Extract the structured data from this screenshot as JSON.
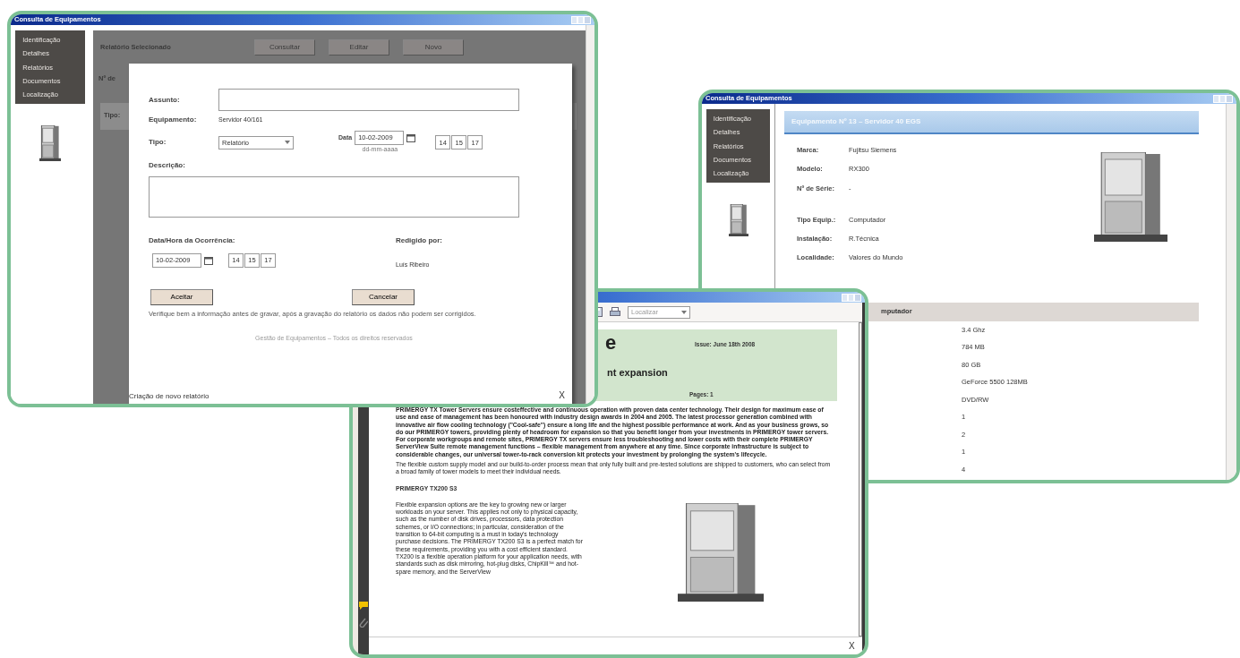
{
  "report_window": {
    "title": "Consulta de Equipamentos",
    "menu": [
      "Identificação",
      "Detalhes",
      "Relatórios",
      "Documentos",
      "Localização"
    ],
    "background": {
      "label": "Relatório Selecionado",
      "buttons": [
        "Consultar",
        "Editar",
        "Novo"
      ],
      "count_label": "Nº de",
      "column": "Tipo:"
    },
    "dialog": {
      "subject_label": "Assunto:",
      "equipment_label": "Equipamento:",
      "equipment": "Servidor 40/161",
      "type_label": "Tipo:",
      "type": "Relatório",
      "date_label": "Data",
      "date": "10-02-2009",
      "time": [
        "14",
        "15",
        "17"
      ],
      "date_hint": "dd-mm-aaaa",
      "description_label": "Descrição:",
      "occurrence_label": "Data/Hora da Ocorrência:",
      "occurrence_date": "10-02-2009",
      "occurrence_time": [
        "14",
        "15",
        "17"
      ],
      "author_label": "Redigido por:",
      "author": "Luís Ribeiro",
      "buttons": [
        "Aceitar",
        "Cancelar"
      ],
      "note": "Verifique bem a informação antes de gravar, após a gravação do relatório os dados não podem ser corrigidos.",
      "footer": "Gestão de Equipamentos – Todos os direitos reservados",
      "title": "Criação de novo relatório",
      "close": "X"
    }
  },
  "details_window": {
    "title": "Consulta de Equipamentos",
    "menu": [
      "Identificação",
      "Detalhes",
      "Relatórios",
      "Documentos",
      "Localização"
    ],
    "header": "Equipamento Nº 13 – Servidor 40 EGS",
    "fields": [
      {
        "label": "Marca:",
        "value": "Fujitsu Siemens"
      },
      {
        "label": "Modelo:",
        "value": "RX300"
      },
      {
        "label": "Nº de Série:",
        "value": "-"
      },
      {
        "label": "Tipo Equip.:",
        "value": "Computador"
      },
      {
        "label": "Instalação:",
        "value": "R.Técnica"
      },
      {
        "label": "Localidade:",
        "value": "Valores do Mundo"
      }
    ],
    "section": "mputador",
    "values": [
      "3.4 Ghz",
      "784 MB",
      "80 GB",
      "GeForce 5500 128MB",
      "DVD/RW",
      "1",
      "2",
      "1",
      "4"
    ]
  },
  "pdf_window": {
    "find": "Localizar",
    "title_fragment": "e",
    "subtitle_fragment": "nt expansion",
    "issue": "Issue: June 18th 2008",
    "pages": "Pages: 1",
    "paragraphs": [
      "PRIMERGY TX Tower Servers ensure costeffective and continuous operation with proven data center technology. Their design for maximum ease of use and ease of management has been honoured with industry design awards in 2004 and 2005. The latest processor generation combined with innovative air flow cooling technology (\"Cool-safe\") ensure a long life and the highest possible performance at work. And as your business grows, so do our PRIMERGY towers, providing plenty of headroom for expansion so that you benefit longer from your investments in PRIMERGY tower servers. For corporate workgroups and remote sites, PRIMERGY TX servers ensure less troubleshooting and lower costs with their complete PRIMERGY ServerView Suite remote management functions – flexible management from anywhere at any time. Since corporate infrastructure is subject to considerable changes, our universal tower-to-rack conversion kit protects your investment by prolonging the system's lifecycle.",
      "The flexible custom supply model and our build-to-order process mean that only fully built and pre-tested solutions are shipped to customers, who can select from a broad family of tower models to meet their individual needs."
    ],
    "section_title": "PRIMERGY TX200 S3",
    "column_text": "Flexible expansion options are the key to growing new or larger workloads on your server. This applies not only to physical capacity, such as the number of disk drives, processors, data protection schemes, or I/O connections; in particular, consideration of the transition to 64-bit computing is a must in today's technology purchase decisions. The PRIMERGY TX200 S3 is a perfect match for these requirements, providing you with a cost efficient standard. TX200 is a flexible operation platform for your application needs, with standards such as disk mirroring, hot-plug disks, ChipKill™ and hot-spare memory, and the ServerView",
    "close": "X"
  }
}
